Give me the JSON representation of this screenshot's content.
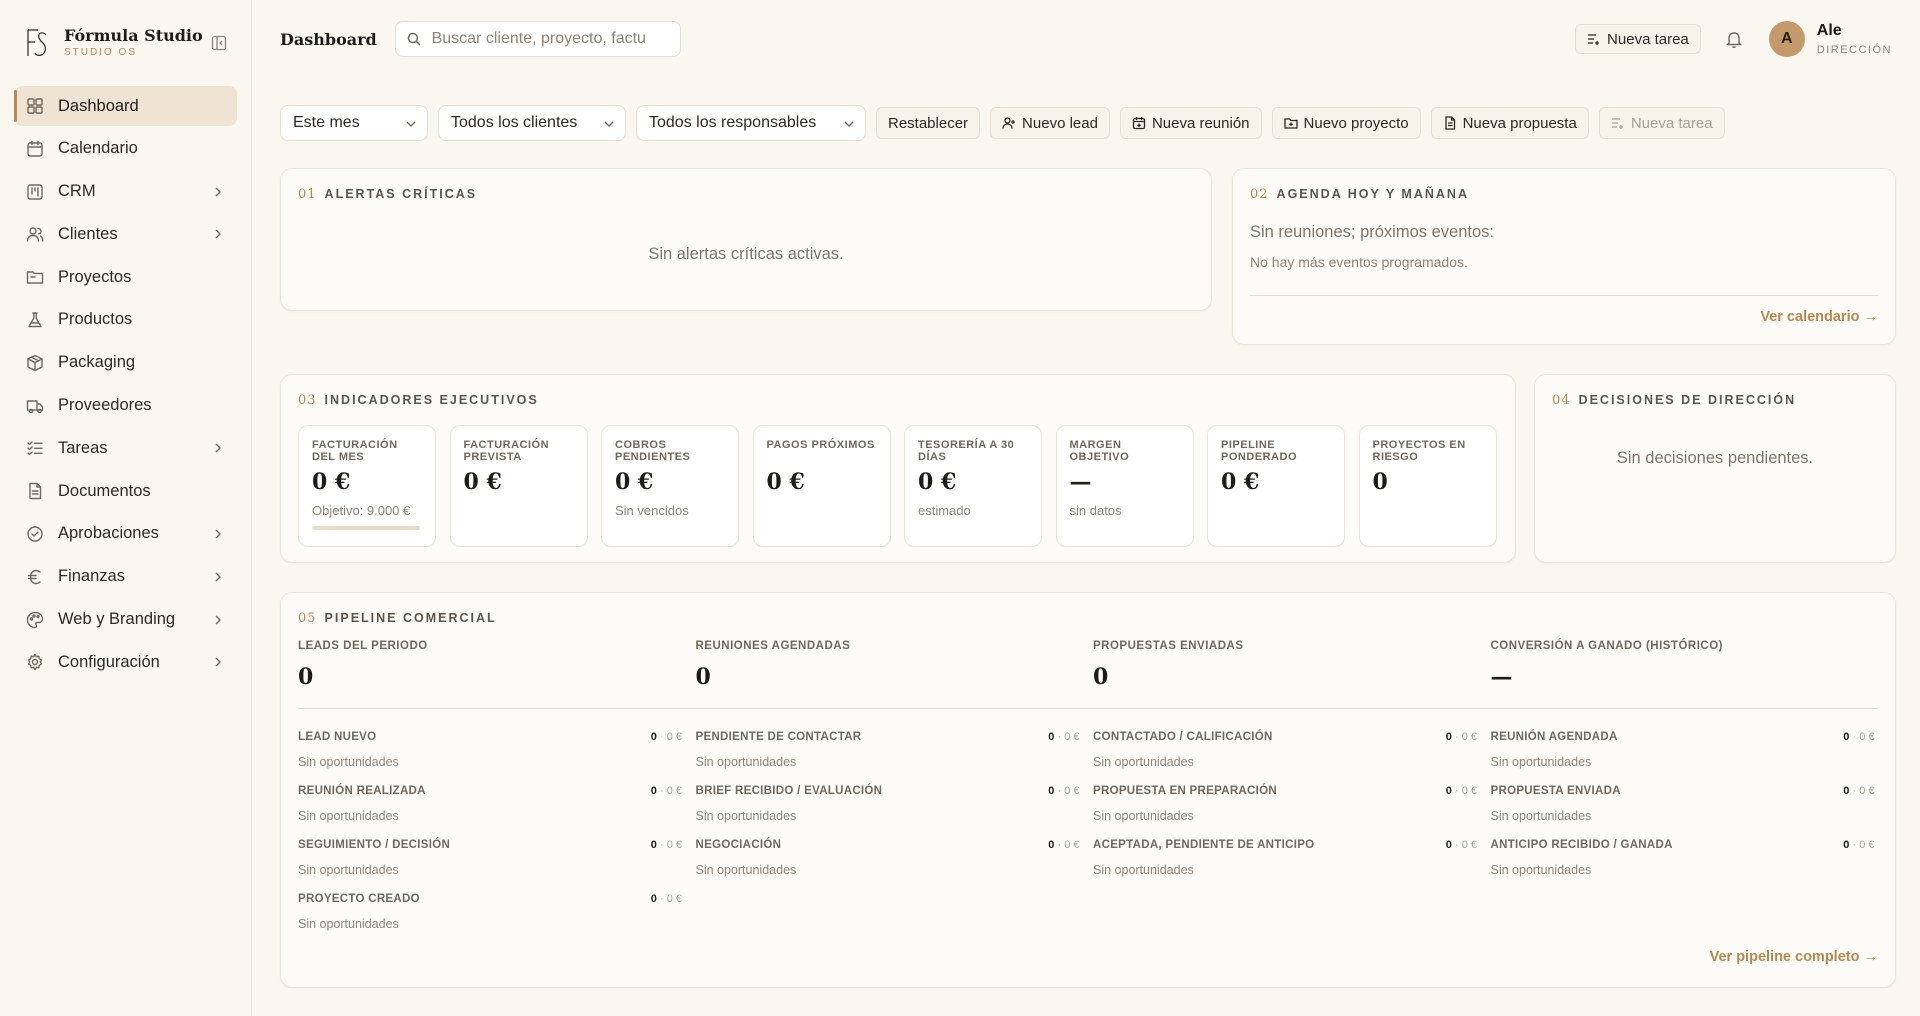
{
  "brand": {
    "name": "Fórmula Studio",
    "sub": "STUDIO OS"
  },
  "sidebar": {
    "items": [
      {
        "label": "Dashboard",
        "icon": "dashboard-icon",
        "active": true,
        "chevron": false
      },
      {
        "label": "Calendario",
        "icon": "calendar-icon",
        "chevron": false
      },
      {
        "label": "CRM",
        "icon": "kanban-icon",
        "chevron": true
      },
      {
        "label": "Clientes",
        "icon": "users-icon",
        "chevron": true
      },
      {
        "label": "Proyectos",
        "icon": "folder-icon",
        "chevron": false
      },
      {
        "label": "Productos",
        "icon": "flask-icon",
        "chevron": false
      },
      {
        "label": "Packaging",
        "icon": "package-icon",
        "chevron": false
      },
      {
        "label": "Proveedores",
        "icon": "truck-icon",
        "chevron": false
      },
      {
        "label": "Tareas",
        "icon": "tasks-icon",
        "chevron": true
      },
      {
        "label": "Documentos",
        "icon": "document-icon",
        "chevron": false
      },
      {
        "label": "Aprobaciones",
        "icon": "check-circle-icon",
        "chevron": true
      },
      {
        "label": "Finanzas",
        "icon": "euro-icon",
        "chevron": true
      },
      {
        "label": "Web y Branding",
        "icon": "palette-icon",
        "chevron": true
      },
      {
        "label": "Configuración",
        "icon": "gear-icon",
        "chevron": true
      }
    ]
  },
  "header": {
    "title": "Dashboard",
    "search_placeholder": "Buscar cliente, proyecto, factu",
    "new_task": "Nueva tarea",
    "user": {
      "initial": "A",
      "name": "Ale",
      "role": "DIRECCIÓN"
    }
  },
  "filters": {
    "period": "Este mes",
    "clients": "Todos los clientes",
    "owners": "Todos los responsables",
    "reset": "Restablecer",
    "new_lead": "Nuevo lead",
    "new_meeting": "Nueva reunión",
    "new_project": "Nuevo proyecto",
    "new_proposal": "Nueva propuesta",
    "new_task": "Nueva tarea"
  },
  "alerts": {
    "num": "01",
    "title": "ALERTAS CRÍTICAS",
    "empty": "Sin alertas críticas activas."
  },
  "agenda": {
    "num": "02",
    "title": "AGENDA HOY Y MAÑANA",
    "line1": "Sin reuniones; próximos eventos:",
    "line2": "No hay más eventos programados.",
    "link": "Ver calendario →"
  },
  "indicators": {
    "num": "03",
    "title": "INDICADORES EJECUTIVOS",
    "kpis": [
      {
        "label": "FACTURACIÓN DEL MES",
        "value": "0 €",
        "sub": "Objetivo: 9.000 €",
        "progress": 0
      },
      {
        "label": "FACTURACIÓN PREVISTA",
        "value": "0 €",
        "sub": ""
      },
      {
        "label": "COBROS PENDIENTES",
        "value": "0 €",
        "sub": "Sin vencidos"
      },
      {
        "label": "PAGOS PRÓXIMOS",
        "value": "0 €",
        "sub": ""
      },
      {
        "label": "TESORERÍA A 30 DÍAS",
        "value": "0 €",
        "sub": "estimado"
      },
      {
        "label": "MARGEN OBJETIVO",
        "value": "—",
        "sub": "sin datos"
      },
      {
        "label": "PIPELINE PONDERADO",
        "value": "0 €",
        "sub": ""
      },
      {
        "label": "PROYECTOS EN RIESGO",
        "value": "0",
        "sub": ""
      }
    ]
  },
  "decisions": {
    "num": "04",
    "title": "DECISIONES DE DIRECCIÓN",
    "empty": "Sin decisiones pendientes."
  },
  "pipeline": {
    "num": "05",
    "title": "PIPELINE COMERCIAL",
    "summary": [
      {
        "label": "LEADS DEL PERIODO",
        "value": "0"
      },
      {
        "label": "REUNIONES AGENDADAS",
        "value": "0"
      },
      {
        "label": "PROPUESTAS ENVIADAS",
        "value": "0"
      },
      {
        "label": "CONVERSIÓN A GANADO (HISTÓRICO)",
        "value": "—"
      }
    ],
    "stages": [
      {
        "name": "LEAD NUEVO",
        "count": "0",
        "amount": "· 0 €",
        "sub": "Sin oportunidades"
      },
      {
        "name": "PENDIENTE DE CONTACTAR",
        "count": "0",
        "amount": "· 0 €",
        "sub": "Sin oportunidades"
      },
      {
        "name": "CONTACTADO / CALIFICACIÓN",
        "count": "0",
        "amount": "· 0 €",
        "sub": "Sin oportunidades"
      },
      {
        "name": "REUNIÓN AGENDADA",
        "count": "0",
        "amount": "· 0 €",
        "sub": "Sin oportunidades"
      },
      {
        "name": "REUNIÓN REALIZADA",
        "count": "0",
        "amount": "· 0 €",
        "sub": "Sin oportunidades"
      },
      {
        "name": "BRIEF RECIBIDO / EVALUACIÓN",
        "count": "0",
        "amount": "· 0 €",
        "sub": "Sin oportunidades"
      },
      {
        "name": "PROPUESTA EN PREPARACIÓN",
        "count": "0",
        "amount": "· 0 €",
        "sub": "Sin oportunidades"
      },
      {
        "name": "PROPUESTA ENVIADA",
        "count": "0",
        "amount": "· 0 €",
        "sub": "Sin oportunidades"
      },
      {
        "name": "SEGUIMIENTO / DECISIÓN",
        "count": "0",
        "amount": "· 0 €",
        "sub": "Sin oportunidades"
      },
      {
        "name": "NEGOCIACIÓN",
        "count": "0",
        "amount": "· 0 €",
        "sub": "Sin oportunidades"
      },
      {
        "name": "ACEPTADA, PENDIENTE DE ANTICIPO",
        "count": "0",
        "amount": "· 0 €",
        "sub": "Sin oportunidades"
      },
      {
        "name": "ANTICIPO RECIBIDO / GANADA",
        "count": "0",
        "amount": "· 0 €",
        "sub": "Sin oportunidades"
      },
      {
        "name": "PROYECTO CREADO",
        "count": "0",
        "amount": "· 0 €",
        "sub": "Sin oportunidades"
      }
    ],
    "link": "Ver pipeline completo →"
  },
  "colors": {
    "accent": "#b58a52",
    "background": "#faf6f0",
    "active_nav": "#efe4d4",
    "avatar": "#c49a6c"
  }
}
